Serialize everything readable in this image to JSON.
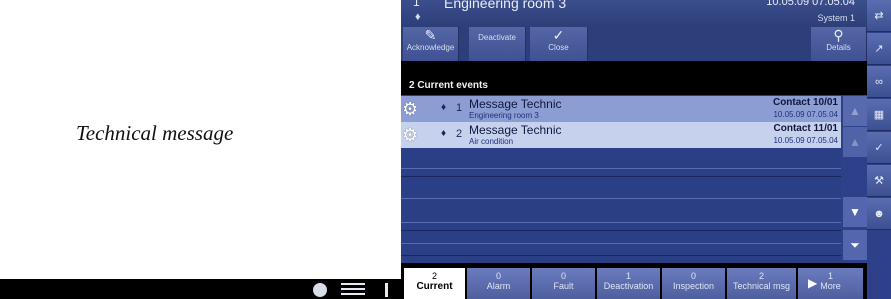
{
  "left": {
    "title": "Technical message"
  },
  "header": {
    "number": "1",
    "title": "Engineering room 3",
    "datetime": "10.05.09 07.05.04",
    "system": "System 1"
  },
  "toolbar": {
    "acknowledge": "Acknowledge",
    "deactivate": "Deactivate",
    "close": "Close",
    "details": "Details"
  },
  "events": {
    "title": "2 Current events",
    "rows": [
      {
        "num": "1",
        "name": "Message Technic",
        "location": "Engineering room 3",
        "contact": "Contact 10/01",
        "time": "10.05.09 07.05.04"
      },
      {
        "num": "2",
        "name": "Message Technic",
        "location": "Air condition",
        "contact": "Contact 11/01",
        "time": "10.05.09 07.05.04"
      }
    ]
  },
  "tabs": [
    {
      "count": "2",
      "label": "Current"
    },
    {
      "count": "0",
      "label": "Alarm"
    },
    {
      "count": "0",
      "label": "Fault"
    },
    {
      "count": "1",
      "label": "Deactivation"
    },
    {
      "count": "0",
      "label": "Inspection"
    },
    {
      "count": "2",
      "label": "Technical msg"
    },
    {
      "count": "1",
      "label": "More"
    }
  ],
  "colors": {
    "header": "#2d3f78",
    "row_selected": "#c6d1ee",
    "row_normal": "#8c9dd4",
    "list_bg": "#2b3f86"
  }
}
